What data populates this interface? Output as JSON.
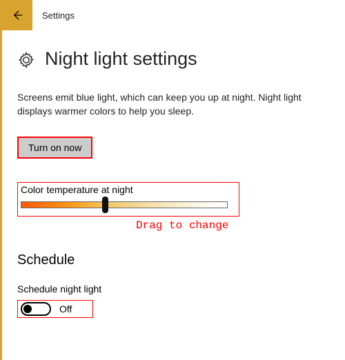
{
  "app_title": "Settings",
  "page_title": "Night light settings",
  "description": "Screens emit blue light, which can keep you up at night. Night light displays warmer colors to help you sleep.",
  "turn_on_label": "Turn on now",
  "slider": {
    "label": "Color temperature at night",
    "value_percent": 40
  },
  "annotation": "Drag to change",
  "schedule": {
    "heading": "Schedule",
    "toggle_label": "Schedule night light",
    "toggle_state_label": "Off",
    "toggle_on": false
  },
  "colors": {
    "accent": "#d8a32e",
    "highlight_box": "#ff0000"
  }
}
